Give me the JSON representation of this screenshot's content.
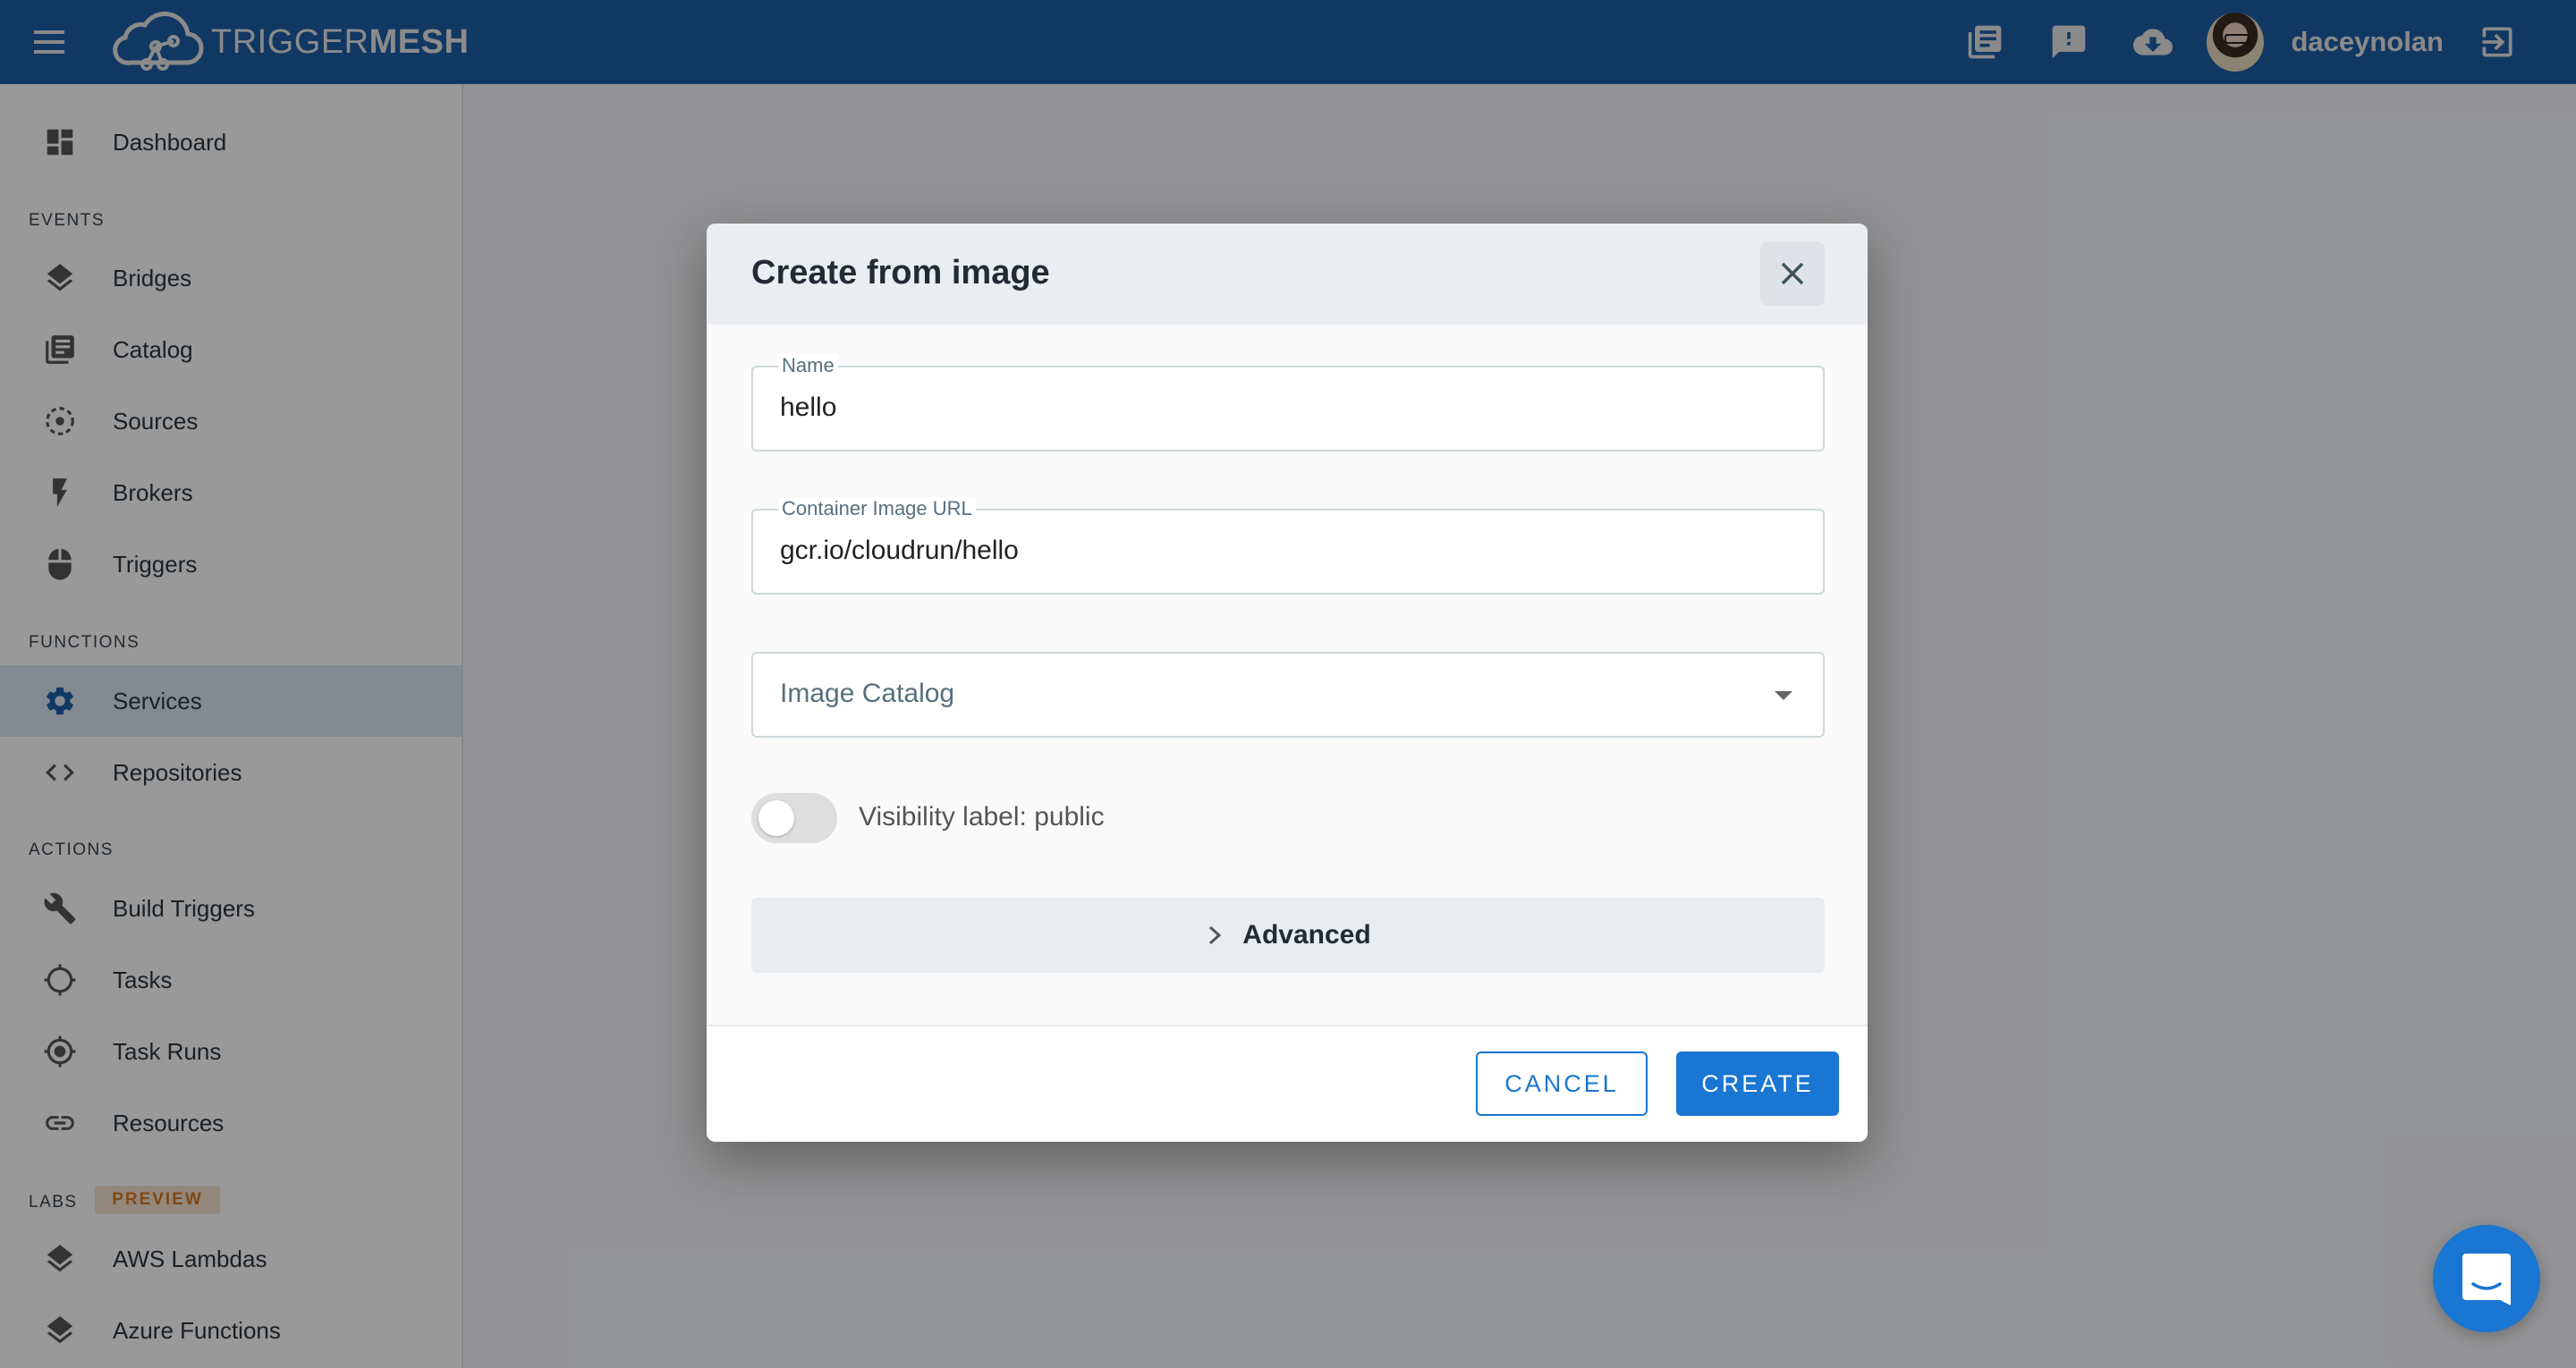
{
  "app": {
    "brand_light": "TRIGGER",
    "brand_bold": "MESH",
    "accent_color": "#1976d2",
    "header_color": "#1d5ea5"
  },
  "topbar": {
    "icons": [
      "library-books-icon",
      "feedback-icon",
      "cloud-download-icon"
    ],
    "username": "daceynolan",
    "logout_icon": "logout-icon"
  },
  "sidebar": {
    "dashboard": {
      "label": "Dashboard",
      "icon": "dashboard-icon"
    },
    "sections": [
      {
        "title": "EVENTS",
        "items": [
          {
            "label": "Bridges",
            "icon": "layers-icon"
          },
          {
            "label": "Catalog",
            "icon": "library-books-icon"
          },
          {
            "label": "Sources",
            "icon": "adjust-dashed-icon"
          },
          {
            "label": "Brokers",
            "icon": "flash-icon"
          },
          {
            "label": "Triggers",
            "icon": "mouse-icon"
          }
        ]
      },
      {
        "title": "FUNCTIONS",
        "items": [
          {
            "label": "Services",
            "icon": "gear-icon",
            "active": true
          },
          {
            "label": "Repositories",
            "icon": "code-icon"
          }
        ]
      },
      {
        "title": "ACTIONS",
        "items": [
          {
            "label": "Build Triggers",
            "icon": "wrench-icon"
          },
          {
            "label": "Tasks",
            "icon": "crosshair-icon"
          },
          {
            "label": "Task Runs",
            "icon": "gps-fixed-icon"
          },
          {
            "label": "Resources",
            "icon": "link-icon"
          }
        ]
      },
      {
        "title": "LABS",
        "badge": "PREVIEW",
        "items": [
          {
            "label": "AWS Lambdas",
            "icon": "layers-icon"
          },
          {
            "label": "Azure Functions",
            "icon": "layers-icon"
          }
        ]
      }
    ]
  },
  "dialog": {
    "title": "Create from image",
    "close_icon": "close-icon",
    "fields": {
      "name": {
        "label": "Name",
        "value": "hello"
      },
      "image_url": {
        "label": "Container Image URL",
        "value": "gcr.io/cloudrun/hello"
      },
      "image_catalog": {
        "placeholder": "Image Catalog",
        "value": ""
      }
    },
    "visibility_toggle": {
      "label": "Visibility label: public",
      "checked": false
    },
    "advanced": {
      "label": "Advanced",
      "expanded": false
    },
    "buttons": {
      "cancel": "CANCEL",
      "create": "CREATE"
    }
  },
  "chat_launcher": {
    "icon": "chat-smile-icon"
  }
}
